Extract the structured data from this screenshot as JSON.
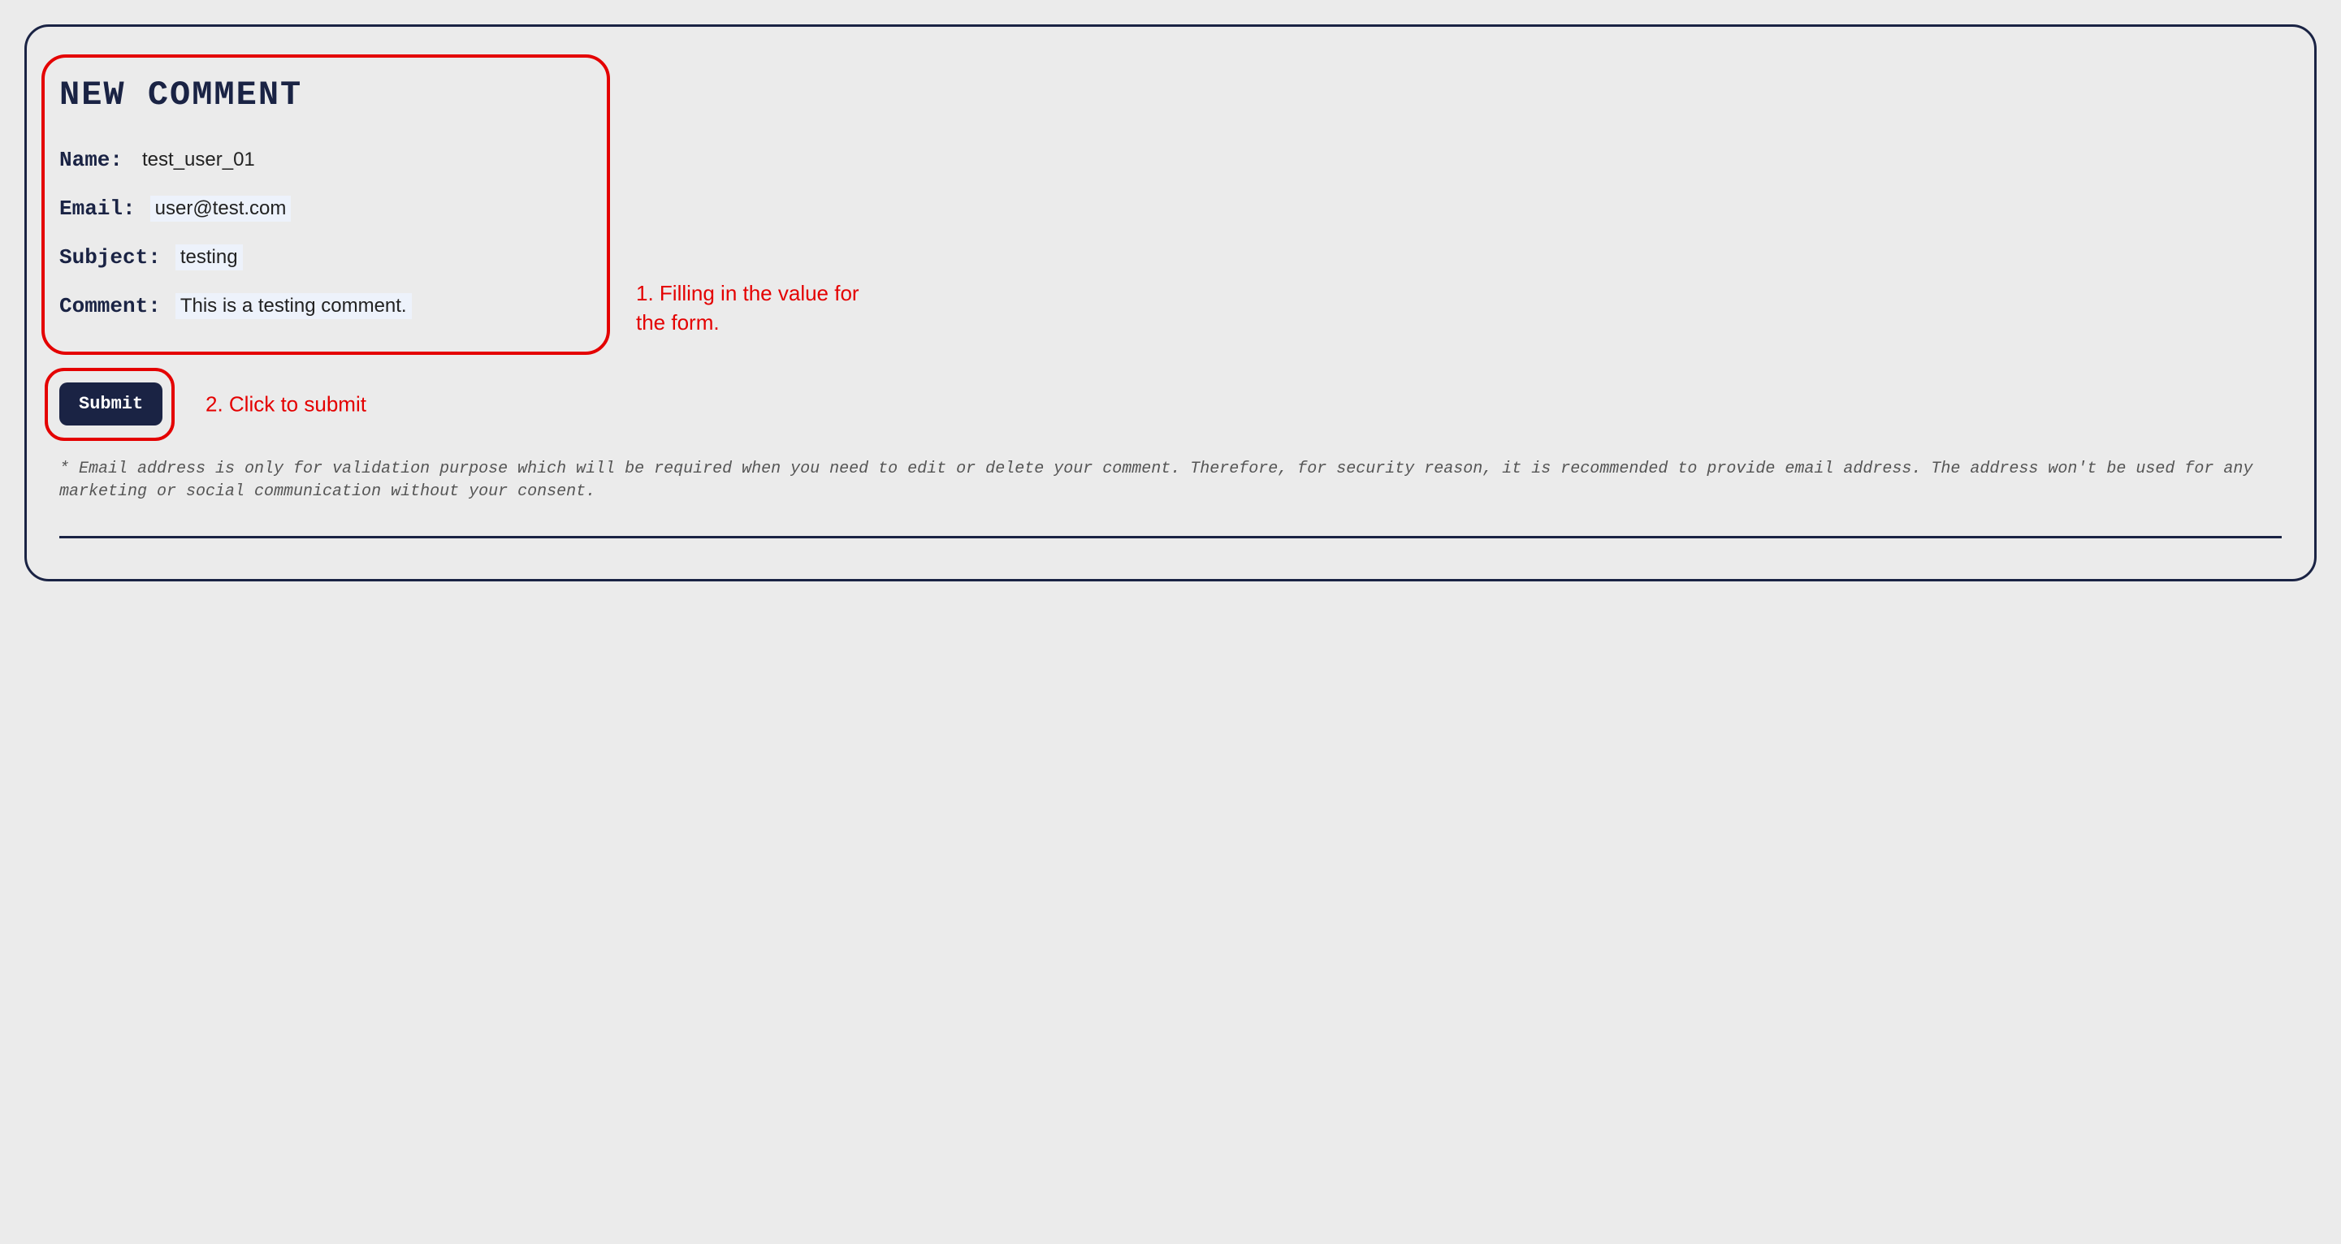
{
  "form": {
    "title": "NEW COMMENT",
    "fields": {
      "name": {
        "label": "Name:",
        "value": "test_user_01"
      },
      "email": {
        "label": "Email:",
        "value": "user@test.com"
      },
      "subject": {
        "label": "Subject:",
        "value": "testing"
      },
      "comment": {
        "label": "Comment:",
        "value": "This is a testing comment."
      }
    },
    "submit_label": "Submit",
    "footnote": "* Email address is only for validation purpose which will be required when you need to edit or delete your comment. Therefore, for security reason, it is recommended to provide email address. The address won't be used for any marketing or social communication without your consent."
  },
  "annotations": {
    "step1": "1. Filling in the value for the form.",
    "step2": "2. Click to submit"
  }
}
